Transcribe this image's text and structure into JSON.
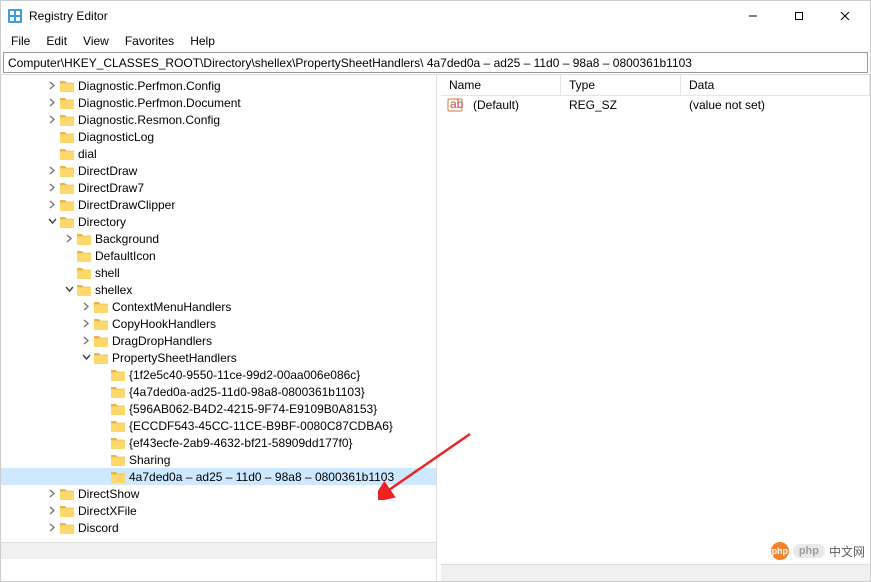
{
  "window": {
    "title": "Registry Editor"
  },
  "menu": {
    "file": "File",
    "edit": "Edit",
    "view": "View",
    "favorites": "Favorites",
    "help": "Help"
  },
  "address": "Computer\\HKEY_CLASSES_ROOT\\Directory\\shellex\\PropertySheetHandlers\\ 4a7ded0a – ad25 – 11d0 – 98a8 – 0800361b1103",
  "tree": {
    "items": [
      {
        "depth": 2,
        "expander": "closed",
        "label": "Diagnostic.Perfmon.Config"
      },
      {
        "depth": 2,
        "expander": "closed",
        "label": "Diagnostic.Perfmon.Document"
      },
      {
        "depth": 2,
        "expander": "closed",
        "label": "Diagnostic.Resmon.Config"
      },
      {
        "depth": 2,
        "expander": "none",
        "label": "DiagnosticLog"
      },
      {
        "depth": 2,
        "expander": "none",
        "label": "dial"
      },
      {
        "depth": 2,
        "expander": "closed",
        "label": "DirectDraw"
      },
      {
        "depth": 2,
        "expander": "closed",
        "label": "DirectDraw7"
      },
      {
        "depth": 2,
        "expander": "closed",
        "label": "DirectDrawClipper"
      },
      {
        "depth": 2,
        "expander": "open",
        "label": "Directory"
      },
      {
        "depth": 3,
        "expander": "closed",
        "label": "Background"
      },
      {
        "depth": 3,
        "expander": "none",
        "label": "DefaultIcon"
      },
      {
        "depth": 3,
        "expander": "none",
        "label": "shell"
      },
      {
        "depth": 3,
        "expander": "open",
        "label": "shellex"
      },
      {
        "depth": 4,
        "expander": "closed",
        "label": "ContextMenuHandlers"
      },
      {
        "depth": 4,
        "expander": "closed",
        "label": "CopyHookHandlers"
      },
      {
        "depth": 4,
        "expander": "closed",
        "label": "DragDropHandlers"
      },
      {
        "depth": 4,
        "expander": "open",
        "label": "PropertySheetHandlers"
      },
      {
        "depth": 5,
        "expander": "none",
        "label": "{1f2e5c40-9550-11ce-99d2-00aa006e086c}"
      },
      {
        "depth": 5,
        "expander": "none",
        "label": "{4a7ded0a-ad25-11d0-98a8-0800361b1103}"
      },
      {
        "depth": 5,
        "expander": "none",
        "label": "{596AB062-B4D2-4215-9F74-E9109B0A8153}"
      },
      {
        "depth": 5,
        "expander": "none",
        "label": "{ECCDF543-45CC-11CE-B9BF-0080C87CDBA6}"
      },
      {
        "depth": 5,
        "expander": "none",
        "label": "{ef43ecfe-2ab9-4632-bf21-58909dd177f0}"
      },
      {
        "depth": 5,
        "expander": "none",
        "label": "Sharing"
      },
      {
        "depth": 5,
        "expander": "none",
        "label": " 4a7ded0a – ad25 – 11d0 – 98a8 – 0800361b1103",
        "selected": true
      },
      {
        "depth": 2,
        "expander": "closed",
        "label": "DirectShow"
      },
      {
        "depth": 2,
        "expander": "closed",
        "label": "DirectXFile"
      },
      {
        "depth": 2,
        "expander": "closed",
        "label": "Discord"
      }
    ]
  },
  "values": {
    "headers": {
      "name": "Name",
      "type": "Type",
      "data": "Data"
    },
    "rows": [
      {
        "name": "(Default)",
        "type": "REG_SZ",
        "data": "(value not set)"
      }
    ]
  },
  "watermark": {
    "badge": "php",
    "text": "中文网"
  }
}
